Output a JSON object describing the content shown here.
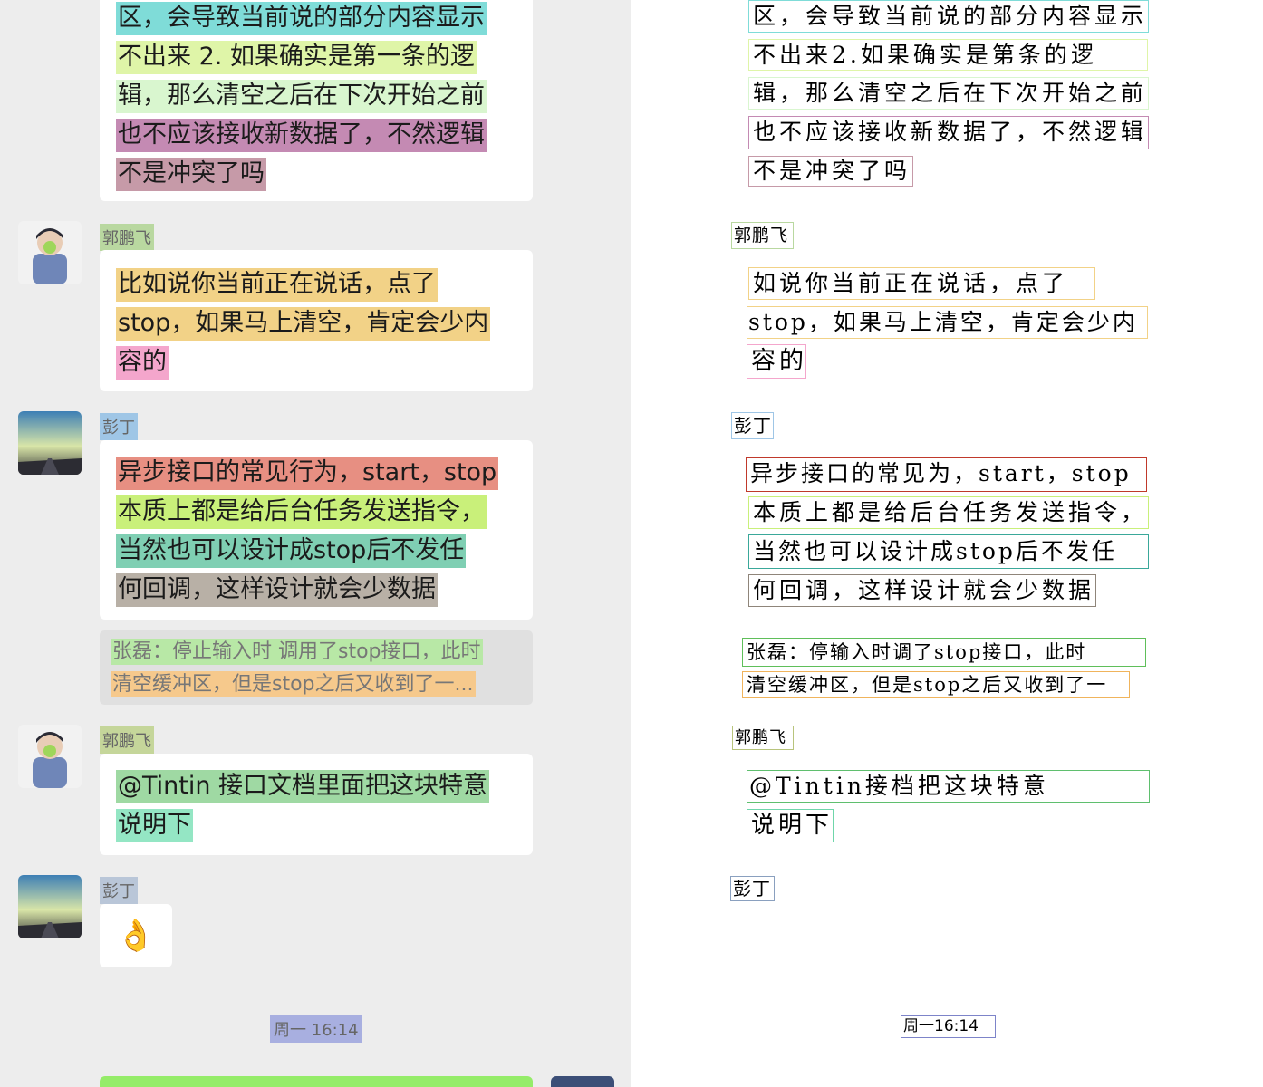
{
  "chat": {
    "msg1": {
      "lines": [
        "区，会导致当前说的部分内容显示",
        "不出来  2. 如果确实是第一条的逻",
        "辑，那么清空之后在下次开始之前",
        "也不应该接收新数据了，不然逻辑",
        "不是冲突了吗"
      ]
    },
    "msg2": {
      "sender": "郭鹏飞",
      "lines": [
        "比如说你当前正在说话，点了",
        "stop，如果马上清空，肯定会少内",
        "容的"
      ]
    },
    "msg3": {
      "sender": "彭丁",
      "lines": [
        "异步接口的常见行为，start，stop",
        "本质上都是给后台任务发送指令，",
        "当然也可以设计成stop后不发任",
        "何回调，这样设计就会少数据"
      ],
      "quote_lines": [
        "张磊：停止输入时 调用了stop接口，此时",
        "清空缓冲区，但是stop之后又收到了一..."
      ]
    },
    "msg4": {
      "sender": "郭鹏飞",
      "lines": [
        "@Tintin  接口文档里面把这块特意",
        "说明下"
      ]
    },
    "msg5": {
      "sender": "彭丁",
      "emoji": "👌"
    },
    "time": "周一 16:14"
  },
  "ocr": {
    "lines": [
      "区，会导致当前说的部分内容显示",
      "不出来2.如果确实是第条的逻",
      "辑，那么清空之后在下次开始之前",
      "也不应该接收新数据了，不然逻辑",
      "不是冲突了吗",
      "郭鹏飞",
      "如说你当前正在说话，点了",
      "stop，如果马上清空，肯定会少内",
      "容的",
      "彭丁",
      "异步接口的常见为，start，stop",
      "本质上都是给后台任务发送指令，",
      "当然也可以设计成stop后不发任",
      "何回调，这样设计就会少数据",
      "张磊：停输入时调了stop接口，此时",
      "清空缓冲区，但是stop之后又收到了一",
      "郭鹏飞",
      "@Tintin接档把这块特意",
      "说明下",
      "彭丁",
      "周一16:14"
    ]
  },
  "colors": {
    "cyan": "#7fdcd8",
    "lime": "#dff5a8",
    "mint": "#d9f6cf",
    "mauve": "#c48ab3",
    "rose": "#c69aa8",
    "olive": "#b9d8a0",
    "gold": "#f2d287",
    "pink": "#f4a6cc",
    "skyblue": "#9fc6e6",
    "salmon": "#e78f82",
    "yellowgreen": "#c9f07a",
    "teal": "#7fcfb3",
    "taupe": "#b8b0a6",
    "lightgreen": "#b8e8a6",
    "peach": "#f6c98c",
    "sage": "#9fd9a3",
    "aqua": "#94e6c4",
    "lavender": "#a8afe0",
    "green_bubble": "#95ec69"
  }
}
